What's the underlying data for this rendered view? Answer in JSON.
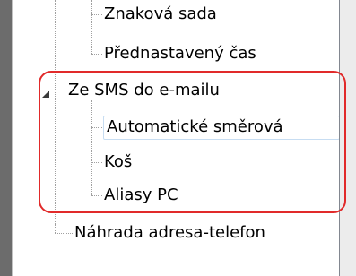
{
  "tree": {
    "items": [
      {
        "label": "Znaková sada"
      },
      {
        "label": "Přednastavený čas"
      },
      {
        "label": "Ze SMS do e-mailu"
      },
      {
        "label": "Automatické směrová"
      },
      {
        "label": "Koš"
      },
      {
        "label": "Aliasy PC"
      },
      {
        "label": "Náhrada adresa-telefon"
      }
    ],
    "expander_icon": "expanded-triangle-icon"
  },
  "colors": {
    "highlight": "#e12a2a",
    "selection_border": "#c7ddf2",
    "connector": "#a0a0a0"
  }
}
